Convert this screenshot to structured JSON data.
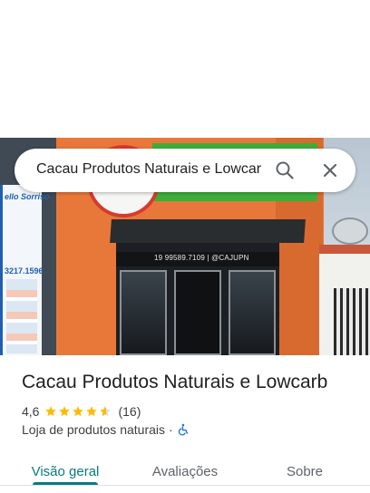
{
  "search": {
    "value": "Cacau Produtos Naturais e Lowcarb",
    "search_icon": "search-icon",
    "close_icon": "close-icon"
  },
  "photo": {
    "sign_left_name": "ello Sorriso",
    "sign_left_phone": "3217.1596",
    "storefront_text": "19 99589.7109 | @CAJUPN"
  },
  "place": {
    "name": "Cacau Produtos Naturais e Lowcarb",
    "rating": "4,6",
    "stars": 4.6,
    "reviews_count": "(16)",
    "category": "Loja de produtos naturais",
    "separator": "·",
    "accessibility_icon": "wheelchair-icon"
  },
  "tabs": [
    {
      "label": "Visão geral",
      "active": true
    },
    {
      "label": "Avaliações",
      "active": false
    },
    {
      "label": "Sobre",
      "active": false
    }
  ],
  "colors": {
    "accent": "#0b7a80",
    "star": "#fbbc04",
    "text_primary": "#202124",
    "text_secondary": "#5f6368"
  }
}
